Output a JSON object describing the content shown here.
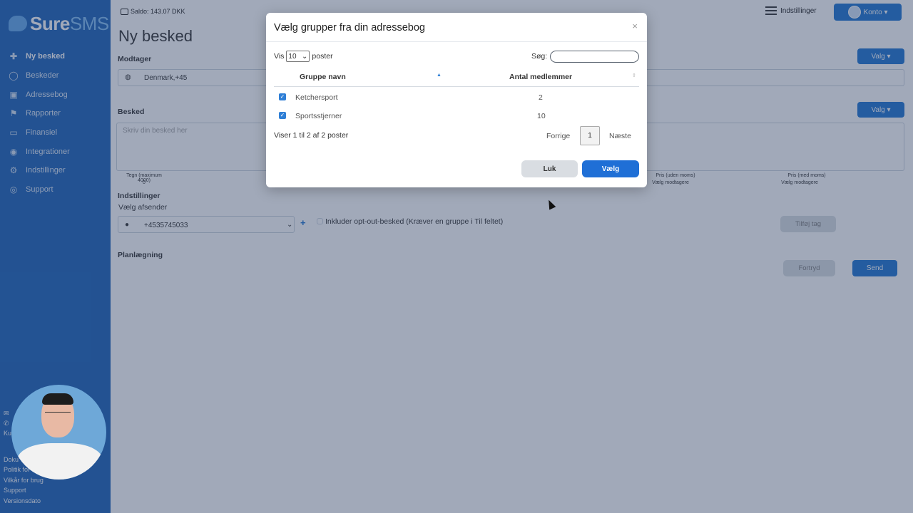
{
  "sidebar": {
    "logo_main": "Sure",
    "logo_accent": "SMS",
    "items": [
      {
        "label": "Ny besked",
        "icon": "plus-icon"
      },
      {
        "label": "Beskeder",
        "icon": "chat-icon"
      },
      {
        "label": "Adressebog",
        "icon": "addressbook-icon"
      },
      {
        "label": "Rapporter",
        "icon": "flag-icon"
      },
      {
        "label": "Finansiel",
        "icon": "money-icon"
      },
      {
        "label": "Integrationer",
        "icon": "globe-icon"
      },
      {
        "label": "Indstillinger",
        "icon": "gear-icon"
      },
      {
        "label": "Support",
        "icon": "lifebuoy-icon"
      }
    ],
    "mini_text": "Ku",
    "footer": [
      "Doku",
      "Politik for",
      "Vilkår for brug",
      "Support",
      "Versionsdato"
    ]
  },
  "topbar": {
    "saldo": "Saldo: 143.07 DKK",
    "settings_label": "Indstillinger",
    "account_label": "Konto ▾"
  },
  "page": {
    "title": "Ny besked",
    "recipient_label": "Modtager",
    "recipient_value": "Denmark,+45",
    "valg_label": "Valg ▾",
    "message_label": "Besked",
    "message_placeholder": "Skriv din besked her",
    "chars_label": "Tegn (maximum 4000)",
    "chars_value": "0",
    "price_ex_label": "Pris (uden moms)",
    "price_ex_value": "Vælg modtagere",
    "price_inc_label": "Pris (med moms)",
    "price_inc_value": "Vælg modtagere",
    "settings_label": "Indstillinger",
    "sender_label": "Vælg afsender",
    "sender_value": "+4535745033",
    "optout_label": "Inkluder opt-out-besked (Kræver en gruppe i Til feltet)",
    "add_tag_label": "Tilføj tag",
    "planning_label": "Planlægning",
    "cancel_label": "Fortryd",
    "send_label": "Send"
  },
  "modal": {
    "title": "Vælg grupper fra din adressebog",
    "close": "×",
    "show_label": "Vis",
    "show_value": "10",
    "entries_label": "poster",
    "search_label": "Søg:",
    "search_value": "",
    "columns": [
      "Gruppe navn",
      "Antal medlemmer"
    ],
    "rows": [
      {
        "checked": true,
        "name": "Ketchersport",
        "members": "2"
      },
      {
        "checked": true,
        "name": "Sportsstjerner",
        "members": "10"
      }
    ],
    "info": "Viser 1 til 2 af 2 poster",
    "prev": "Forrige",
    "page": "1",
    "next": "Næste",
    "close_button": "Luk",
    "select_button": "Vælg"
  }
}
